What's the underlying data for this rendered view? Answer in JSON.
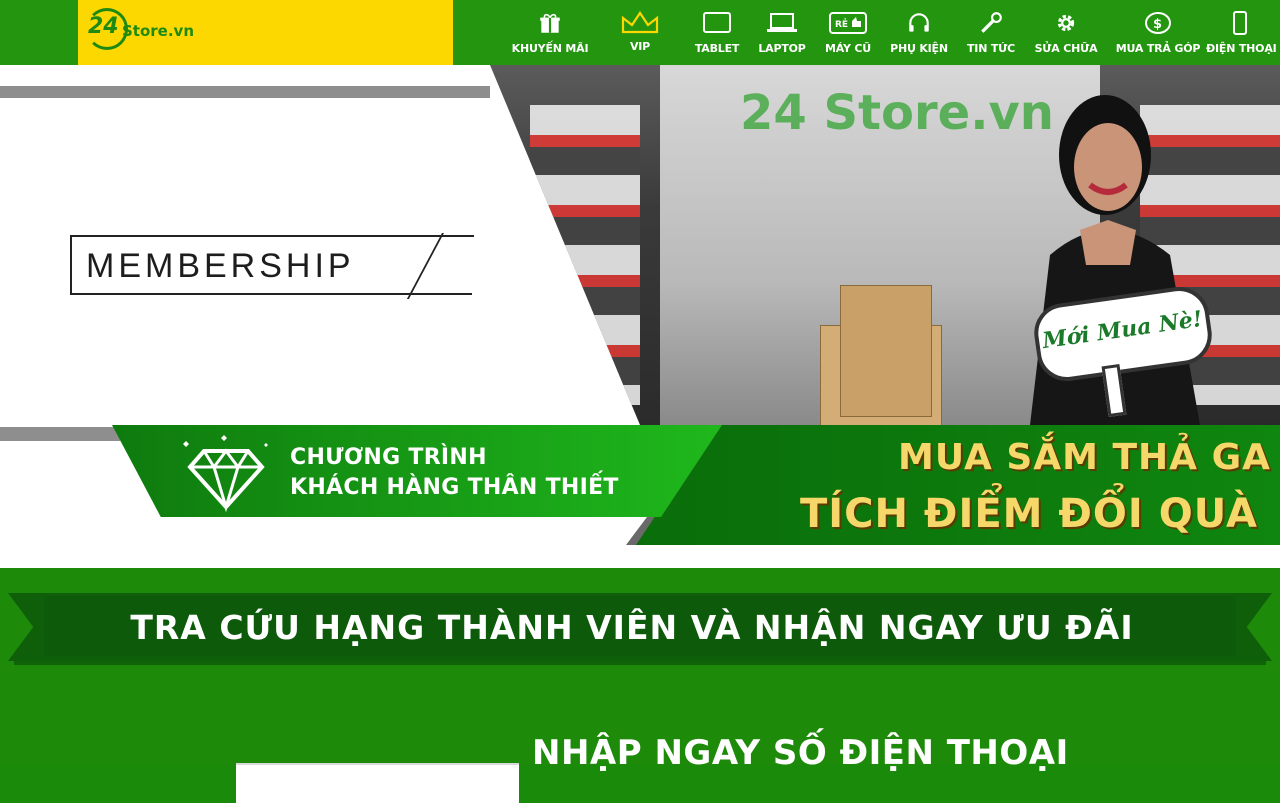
{
  "brand": {
    "logo_number": "24",
    "logo_text": "Store.vn"
  },
  "nav": {
    "items": [
      {
        "label": "KHUYẾN MÃI",
        "icon": "gift-icon"
      },
      {
        "label": "VIP",
        "icon": "crown-icon"
      },
      {
        "label": "TABLET",
        "icon": "tablet-icon"
      },
      {
        "label": "LAPTOP",
        "icon": "laptop-icon"
      },
      {
        "label": "MÁY CŨ",
        "icon": "used-device-icon"
      },
      {
        "label": "PHỤ KIỆN",
        "icon": "headphones-icon"
      },
      {
        "label": "TIN TỨC",
        "icon": "tools-icon"
      },
      {
        "label": "SỬA CHỮA",
        "icon": "gear-icon"
      },
      {
        "label": "MUA TRẢ GÓP",
        "icon": "installment-icon"
      },
      {
        "label": "ĐIỆN THOẠI",
        "icon": "phone-icon"
      }
    ]
  },
  "banner": {
    "membership": "MEMBERSHIP",
    "program_line1": "CHƯƠNG TRÌNH",
    "program_line2": "KHÁCH HÀNG THÂN THIẾT",
    "promo_line1": "MUA SẮM THẢ GA",
    "promo_line2": "TÍCH ĐIỂM ĐỔI QUÀ",
    "sign_text": "Mới Mua Nè!",
    "store_sign": "24 Store.vn"
  },
  "lookup": {
    "section_title": "TRA CỨU HẠNG THÀNH VIÊN VÀ NHẬN NGAY ƯU ĐÃI",
    "enter_title": "NHẬP NGAY SỐ ĐIỆN THOẠI"
  },
  "colors": {
    "nav_green": "#23950f",
    "logo_yellow": "#fcd800",
    "section_green": "#1d8a0a",
    "gold": "#f6d86a"
  }
}
